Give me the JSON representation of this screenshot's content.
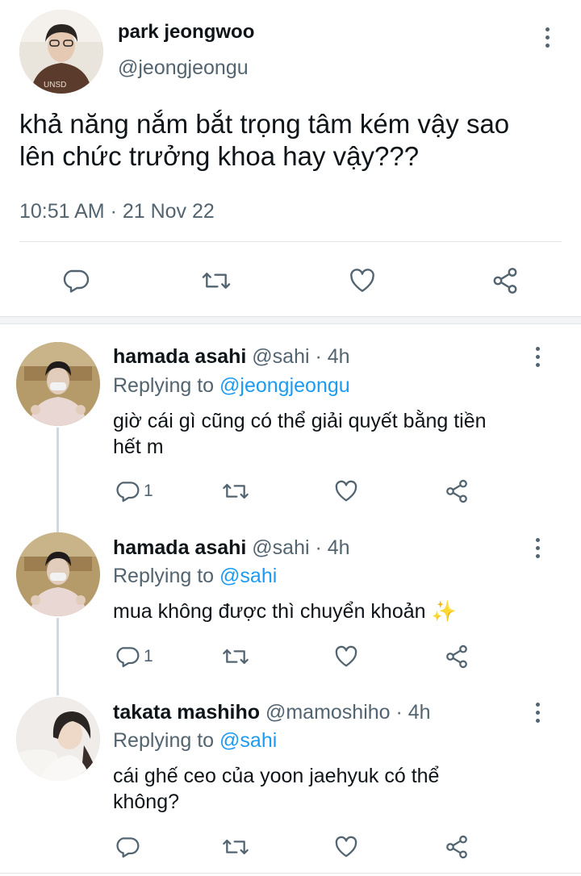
{
  "main_tweet": {
    "name": "park jeongwoo",
    "handle": "@jeongjeongu",
    "text_line1": "khả năng nắm bắt trọng tâm kém vậy sao",
    "text_line2": "lên chức trưởng khoa hay vậy???",
    "timestamp": "10:51 AM · 21 Nov 22",
    "actions": [
      "reply-icon",
      "retweet-icon",
      "like-icon",
      "share-icon"
    ]
  },
  "replies": [
    {
      "name": "hamada asahi",
      "meta": " @sahi · 4h",
      "replying_prefix": "Replying to ",
      "replying_to": "@jeongjeongu",
      "text_line1": "giờ cái gì cũng có thể giải quyết bằng tiền",
      "text_line2": "hết m",
      "reply_count": "1"
    },
    {
      "name": "hamada asahi",
      "meta": " @sahi · 4h",
      "replying_prefix": "Replying to ",
      "replying_to": "@sahi",
      "text_line1": "mua không được thì chuyển khoản ✨",
      "reply_count": "1"
    },
    {
      "name": "takata mashiho",
      "meta": " @mamoshiho · 4h",
      "replying_prefix": "Replying to ",
      "replying_to": "@sahi",
      "text_line1": "cái ghế ceo của yoon jaehyuk có thể",
      "text_line2": "không?",
      "reply_count": ""
    }
  ],
  "colors": {
    "text": "#0f1419",
    "secondary": "#536471",
    "link": "#1d9bf0",
    "divider": "#e1e4e8"
  }
}
